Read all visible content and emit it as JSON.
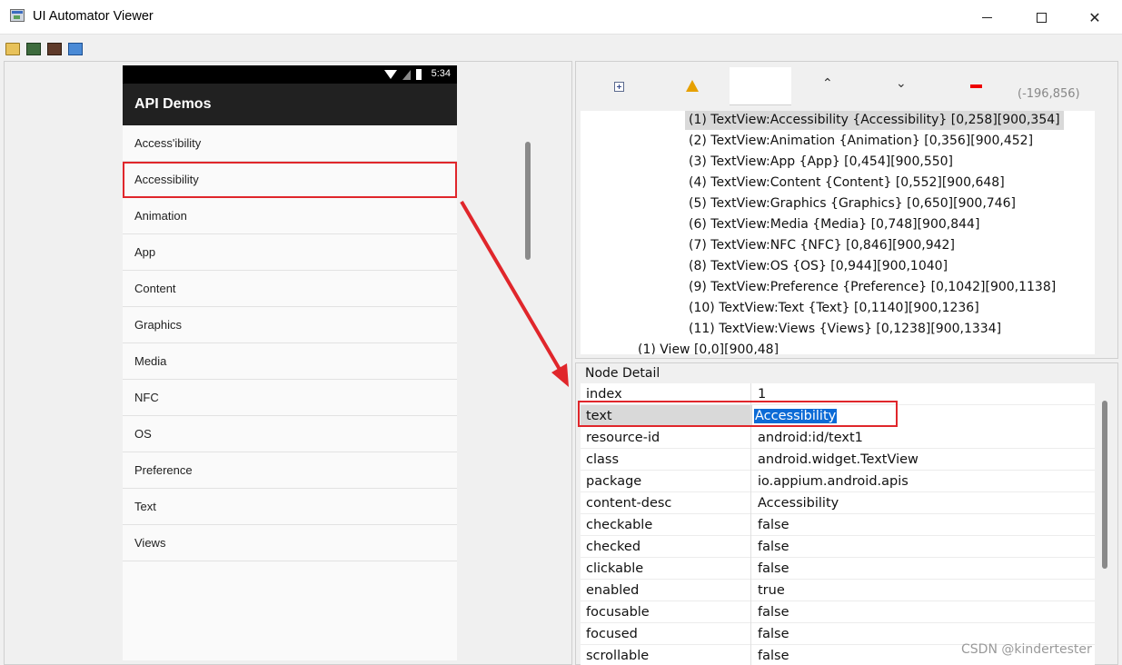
{
  "window": {
    "title": "UI Automator Viewer",
    "minimize": "",
    "maximize": "",
    "close": "✕"
  },
  "device": {
    "status_time": "5:34",
    "app_title": "API Demos",
    "list_items": [
      "Access'ibility",
      "Accessibility",
      "Animation",
      "App",
      "Content",
      "Graphics",
      "Media",
      "NFC",
      "OS",
      "Preference",
      "Text",
      "Views"
    ],
    "highlighted_index": 1
  },
  "tree_toolbar": {
    "up": "⌃",
    "down": "⌄",
    "coordinates": "(-196,856)"
  },
  "tree": {
    "rows": [
      "(1) TextView:Accessibility {Accessibility} [0,258][900,354]",
      "(2) TextView:Animation {Animation} [0,356][900,452]",
      "(3) TextView:App {App} [0,454][900,550]",
      "(4) TextView:Content {Content} [0,552][900,648]",
      "(5) TextView:Graphics {Graphics} [0,650][900,746]",
      "(6) TextView:Media {Media} [0,748][900,844]",
      "(7) TextView:NFC {NFC} [0,846][900,942]",
      "(8) TextView:OS {OS} [0,944][900,1040]",
      "(9) TextView:Preference {Preference} [0,1042][900,1138]",
      "(10) TextView:Text {Text} [0,1140][900,1236]",
      "(11) TextView:Views {Views} [0,1238][900,1334]",
      "(1) View [0,0][900,48]"
    ],
    "selected_index": 0
  },
  "node_detail": {
    "title": "Node Detail",
    "rows": [
      {
        "key": "index",
        "value": "1"
      },
      {
        "key": "text",
        "value": "Accessibility"
      },
      {
        "key": "resource-id",
        "value": "android:id/text1"
      },
      {
        "key": "class",
        "value": "android.widget.TextView"
      },
      {
        "key": "package",
        "value": "io.appium.android.apis"
      },
      {
        "key": "content-desc",
        "value": "Accessibility"
      },
      {
        "key": "checkable",
        "value": "false"
      },
      {
        "key": "checked",
        "value": "false"
      },
      {
        "key": "clickable",
        "value": "false"
      },
      {
        "key": "enabled",
        "value": "true"
      },
      {
        "key": "focusable",
        "value": "false"
      },
      {
        "key": "focused",
        "value": "false"
      },
      {
        "key": "scrollable",
        "value": "false"
      }
    ],
    "selected_index": 1
  },
  "watermark": "CSDN @kindertester",
  "colors": {
    "highlight_red": "#e0262b",
    "selection_blue": "#0c6bd6"
  }
}
